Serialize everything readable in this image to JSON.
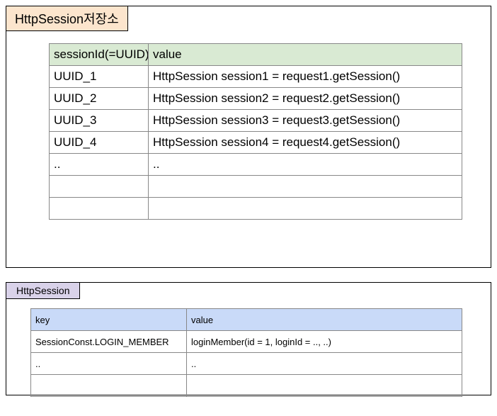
{
  "panel1": {
    "title": "HttpSession저장소",
    "headers": {
      "col1": "sessionId(=UUID)",
      "col2": "value"
    },
    "rows": [
      {
        "c1": "UUID_1",
        "c2": "HttpSession session1 = request1.getSession()"
      },
      {
        "c1": "UUID_2",
        "c2": "HttpSession session2 = request2.getSession()"
      },
      {
        "c1": "UUID_3",
        "c2": "HttpSession session3 = request3.getSession()"
      },
      {
        "c1": "UUID_4",
        "c2": "HttpSession session4 = request4.getSession()"
      },
      {
        "c1": "..",
        "c2": ".."
      },
      {
        "c1": "",
        "c2": ""
      },
      {
        "c1": "",
        "c2": ""
      }
    ]
  },
  "panel2": {
    "title": "HttpSession",
    "headers": {
      "col1": "key",
      "col2": "value"
    },
    "rows": [
      {
        "c1": "SessionConst.LOGIN_MEMBER",
        "c2": "loginMember(id = 1, loginId = .., ..)"
      },
      {
        "c1": "..",
        "c2": ".."
      },
      {
        "c1": "",
        "c2": ""
      }
    ]
  }
}
